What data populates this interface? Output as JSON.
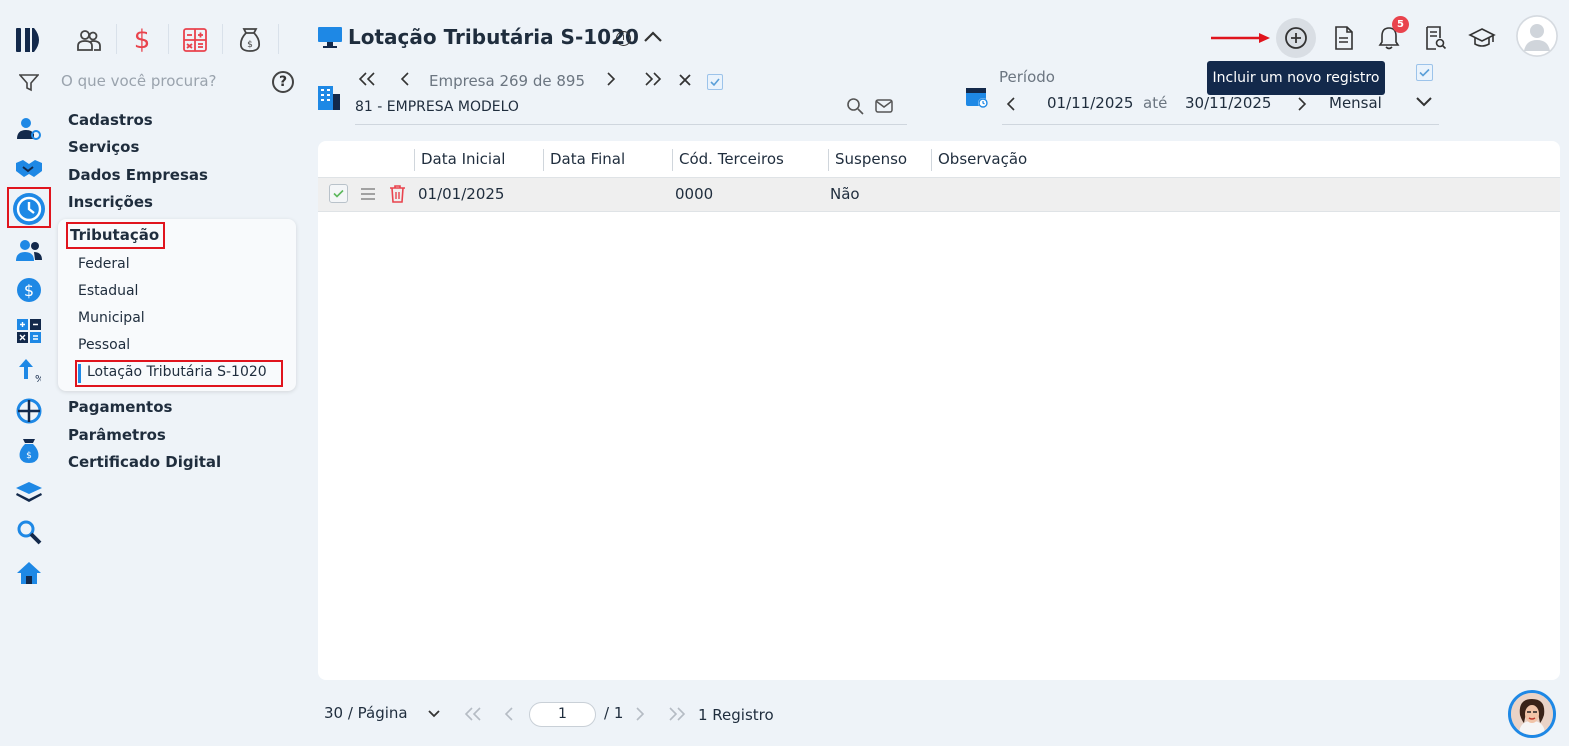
{
  "app": {
    "top_icons": [
      "people-icon",
      "dollar-icon",
      "calculator-icon",
      "money-bag-icon"
    ]
  },
  "search": {
    "placeholder": "O que você procura?",
    "help": "?"
  },
  "menu": {
    "items": [
      "Cadastros",
      "Serviços",
      "Dados Empresas",
      "Inscrições",
      "Tributação",
      "Pagamentos",
      "Parâmetros",
      "Certificado Digital"
    ],
    "tributacao_sub": [
      "Federal",
      "Estadual",
      "Municipal",
      "Pessoal",
      "Lotação Tributária S-1020"
    ]
  },
  "header": {
    "title": "Lotação Tributária S-1020",
    "company_nav": "Empresa 269 de 895",
    "company_name": "81 - EMPRESA MODELO",
    "periodo_label": "Período",
    "date_from": "01/11/2025",
    "ate": "até",
    "date_to": "30/11/2025",
    "frequency": "Mensal",
    "notification_count": "5",
    "tooltip": "Incluir um novo registro"
  },
  "table": {
    "columns": [
      "Data Inicial",
      "Data Final",
      "Cód. Terceiros",
      "Suspenso",
      "Observação"
    ],
    "rows": [
      {
        "data_inicial": "01/01/2025",
        "data_final": "",
        "cod_terceiros": "0000",
        "suspenso": "Não",
        "observacao": ""
      }
    ]
  },
  "footer": {
    "per_page": "30 / Página",
    "page": "1",
    "total_pages": "/ 1",
    "records": "1 Registro"
  },
  "colors": {
    "accent": "#1e88e5",
    "danger": "#e0141d",
    "tooltip": "#13294b",
    "brand": "#13294b"
  }
}
